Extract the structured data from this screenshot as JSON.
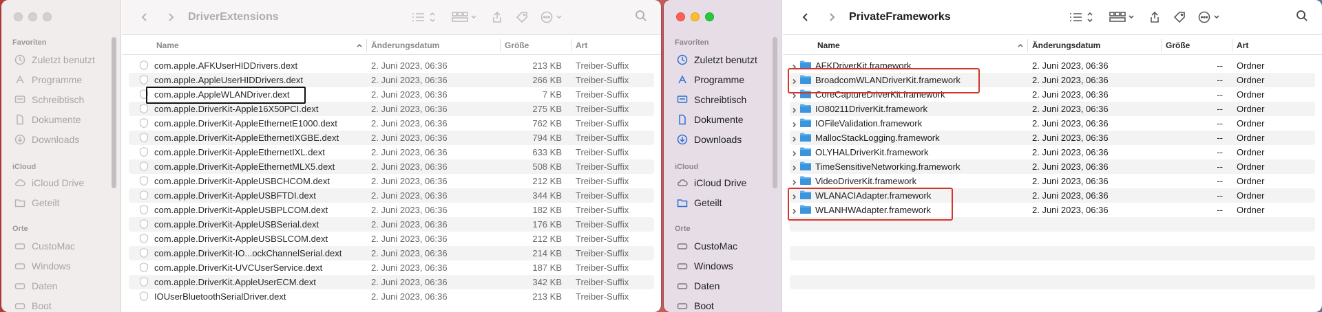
{
  "left": {
    "title": "DriverExtensions",
    "sidebar": {
      "favorites_label": "Favoriten",
      "favorites": [
        {
          "label": "Zuletzt benutzt",
          "icon": "clock-icon"
        },
        {
          "label": "Programme",
          "icon": "apps-icon"
        },
        {
          "label": "Schreibtisch",
          "icon": "desktop-icon"
        },
        {
          "label": "Dokumente",
          "icon": "document-icon"
        },
        {
          "label": "Downloads",
          "icon": "download-icon"
        }
      ],
      "icloud_label": "iCloud",
      "icloud": [
        {
          "label": "iCloud Drive",
          "icon": "cloud-icon"
        },
        {
          "label": "Geteilt",
          "icon": "shared-folder-icon"
        }
      ],
      "locations_label": "Orte",
      "locations": [
        {
          "label": "CustoMac",
          "icon": "disk-icon"
        },
        {
          "label": "Windows",
          "icon": "disk-icon"
        },
        {
          "label": "Daten",
          "icon": "disk-icon"
        },
        {
          "label": "Boot",
          "icon": "disk-icon"
        }
      ]
    },
    "columns": {
      "name": "Name",
      "date": "Änderungsdatum",
      "size": "Größe",
      "kind": "Art"
    },
    "rows": [
      {
        "name": "com.apple.AFKUserHIDDrivers.dext",
        "date": "2. Juni 2023, 06:36",
        "size": "213 KB",
        "kind": "Treiber-Suffix"
      },
      {
        "name": "com.apple.AppleUserHIDDrivers.dext",
        "date": "2. Juni 2023, 06:36",
        "size": "266 KB",
        "kind": "Treiber-Suffix"
      },
      {
        "name": "com.apple.AppleWLANDriver.dext",
        "date": "2. Juni 2023, 06:36",
        "size": "7 KB",
        "kind": "Treiber-Suffix"
      },
      {
        "name": "com.apple.DriverKit-Apple16X50PCI.dext",
        "date": "2. Juni 2023, 06:36",
        "size": "275 KB",
        "kind": "Treiber-Suffix"
      },
      {
        "name": "com.apple.DriverKit-AppleEthernetE1000.dext",
        "date": "2. Juni 2023, 06:36",
        "size": "762 KB",
        "kind": "Treiber-Suffix"
      },
      {
        "name": "com.apple.DriverKit-AppleEthernetIXGBE.dext",
        "date": "2. Juni 2023, 06:36",
        "size": "794 KB",
        "kind": "Treiber-Suffix"
      },
      {
        "name": "com.apple.DriverKit-AppleEthernetIXL.dext",
        "date": "2. Juni 2023, 06:36",
        "size": "633 KB",
        "kind": "Treiber-Suffix"
      },
      {
        "name": "com.apple.DriverKit-AppleEthernetMLX5.dext",
        "date": "2. Juni 2023, 06:36",
        "size": "508 KB",
        "kind": "Treiber-Suffix"
      },
      {
        "name": "com.apple.DriverKit-AppleUSBCHCOM.dext",
        "date": "2. Juni 2023, 06:36",
        "size": "212 KB",
        "kind": "Treiber-Suffix"
      },
      {
        "name": "com.apple.DriverKit-AppleUSBFTDI.dext",
        "date": "2. Juni 2023, 06:36",
        "size": "344 KB",
        "kind": "Treiber-Suffix"
      },
      {
        "name": "com.apple.DriverKit-AppleUSBPLCOM.dext",
        "date": "2. Juni 2023, 06:36",
        "size": "182 KB",
        "kind": "Treiber-Suffix"
      },
      {
        "name": "com.apple.DriverKit-AppleUSBSerial.dext",
        "date": "2. Juni 2023, 06:36",
        "size": "176 KB",
        "kind": "Treiber-Suffix"
      },
      {
        "name": "com.apple.DriverKit-AppleUSBSLCOM.dext",
        "date": "2. Juni 2023, 06:36",
        "size": "212 KB",
        "kind": "Treiber-Suffix"
      },
      {
        "name": "com.apple.DriverKit-IO...ockChannelSerial.dext",
        "date": "2. Juni 2023, 06:36",
        "size": "214 KB",
        "kind": "Treiber-Suffix"
      },
      {
        "name": "com.apple.DriverKit-UVCUserService.dext",
        "date": "2. Juni 2023, 06:36",
        "size": "187 KB",
        "kind": "Treiber-Suffix"
      },
      {
        "name": "com.apple.DriverKit.AppleUserECM.dext",
        "date": "2. Juni 2023, 06:36",
        "size": "342 KB",
        "kind": "Treiber-Suffix"
      },
      {
        "name": "IOUserBluetoothSerialDriver.dext",
        "date": "2. Juni 2023, 06:36",
        "size": "213 KB",
        "kind": "Treiber-Suffix"
      }
    ]
  },
  "right": {
    "title": "PrivateFrameworks",
    "sidebar": {
      "favorites_label": "Favoriten",
      "favorites": [
        {
          "label": "Zuletzt benutzt",
          "icon": "clock-icon"
        },
        {
          "label": "Programme",
          "icon": "apps-icon"
        },
        {
          "label": "Schreibtisch",
          "icon": "desktop-icon"
        },
        {
          "label": "Dokumente",
          "icon": "document-icon"
        },
        {
          "label": "Downloads",
          "icon": "download-icon"
        }
      ],
      "icloud_label": "iCloud",
      "icloud": [
        {
          "label": "iCloud Drive",
          "icon": "cloud-icon"
        },
        {
          "label": "Geteilt",
          "icon": "shared-folder-icon"
        }
      ],
      "locations_label": "Orte",
      "locations": [
        {
          "label": "CustoMac",
          "icon": "disk-icon"
        },
        {
          "label": "Windows",
          "icon": "disk-icon"
        },
        {
          "label": "Daten",
          "icon": "disk-icon"
        },
        {
          "label": "Boot",
          "icon": "disk-icon"
        }
      ]
    },
    "columns": {
      "name": "Name",
      "date": "Änderungsdatum",
      "size": "Größe",
      "kind": "Art"
    },
    "rows": [
      {
        "name": "AFKDriverKit.framework",
        "date": "2. Juni 2023, 06:36",
        "size": "--",
        "kind": "Ordner"
      },
      {
        "name": "BroadcomWLANDriverKit.framework",
        "date": "2. Juni 2023, 06:36",
        "size": "--",
        "kind": "Ordner"
      },
      {
        "name": "CoreCaptureDriverKit.framework",
        "date": "2. Juni 2023, 06:36",
        "size": "--",
        "kind": "Ordner"
      },
      {
        "name": "IO80211DriverKit.framework",
        "date": "2. Juni 2023, 06:36",
        "size": "--",
        "kind": "Ordner"
      },
      {
        "name": "IOFileValidation.framework",
        "date": "2. Juni 2023, 06:36",
        "size": "--",
        "kind": "Ordner"
      },
      {
        "name": "MallocStackLogging.framework",
        "date": "2. Juni 2023, 06:36",
        "size": "--",
        "kind": "Ordner"
      },
      {
        "name": "OLYHALDriverKit.framework",
        "date": "2. Juni 2023, 06:36",
        "size": "--",
        "kind": "Ordner"
      },
      {
        "name": "TimeSensitiveNetworking.framework",
        "date": "2. Juni 2023, 06:36",
        "size": "--",
        "kind": "Ordner"
      },
      {
        "name": "VideoDriverKit.framework",
        "date": "2. Juni 2023, 06:36",
        "size": "--",
        "kind": "Ordner"
      },
      {
        "name": "WLANACIAdapter.framework",
        "date": "2. Juni 2023, 06:36",
        "size": "--",
        "kind": "Ordner"
      },
      {
        "name": "WLANHWAdapter.framework",
        "date": "2. Juni 2023, 06:36",
        "size": "--",
        "kind": "Ordner"
      }
    ]
  },
  "colors": {
    "accent": "#2b6fd6",
    "highlight_red": "#d0372c",
    "folder_blue": "#4aa3e8"
  }
}
